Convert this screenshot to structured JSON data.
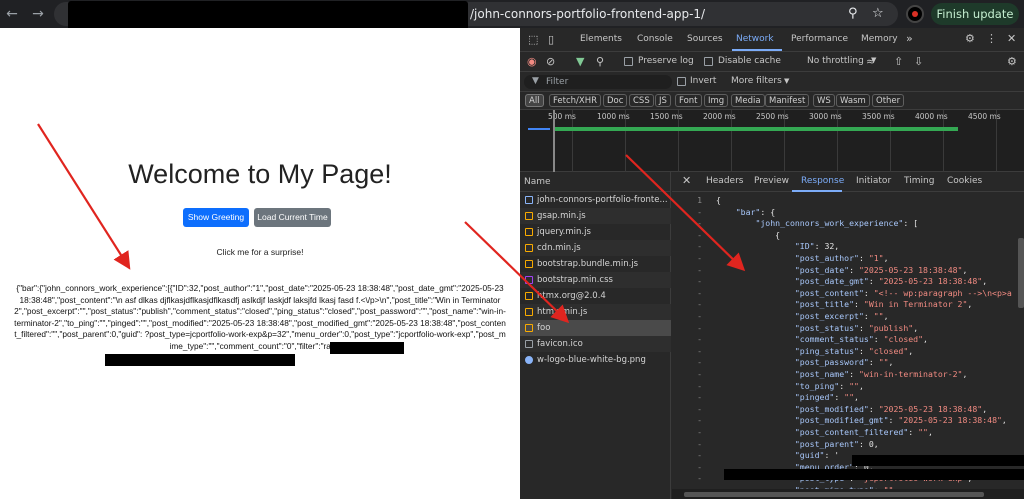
{
  "browser": {
    "url_suffix": "/john-connors-portfolio-frontend-app-1/",
    "update_label": "Finish update"
  },
  "page": {
    "title": "Welcome to My Page!",
    "buttons": [
      "Show Greeting",
      "Load Current Time"
    ],
    "surprise_text": "Click me for a surprise!",
    "json_text": "{\"bar\":{\"john_connors_work_experience\":[{\"ID\":32,\"post_author\":\"1\",\"post_date\":\"2025-05-23 18:38:48\",\"post_date_gmt\":\"2025-05-23 18:38:48\",\"post_content\":\"\\n asf dlkas djflkasjdflkasjdflkasdfj aslkdjf laskjdf laksjfd lkasj fasd f.<\\/p>\\n\",\"post_title\":\"Win in Terminator 2\",\"post_excerpt\":\"\",\"post_status\":\"publish\",\"comment_status\":\"closed\",\"ping_status\":\"closed\",\"post_password\":\"\",\"post_name\":\"win-in-terminator-2\",\"to_ping\":\"\",\"pinged\":\"\",\"post_modified\":\"2025-05-23 18:38:48\",\"post_modified_gmt\":\"2025-05-23 18:38:48\",\"post_content_filtered\":\"\",\"post_parent\":0,\"guid\": ?post_type=jcportfolio-work-exp&p=32\",\"menu_order\":0,\"post_type\":\"jcportfolio-work-exp\",\"post_mime_type\":\"\",\"comment_count\":\"0\",\"filter\":\"raw\"}]}}"
  },
  "devtools": {
    "tabs": [
      "Elements",
      "Console",
      "Sources",
      "Network",
      "Performance",
      "Memory"
    ],
    "active_tab": "Network",
    "preserve_log": "Preserve log",
    "disable_cache": "Disable cache",
    "throttling": "No throttling",
    "filter_placeholder": "Filter",
    "invert": "Invert",
    "more_filters": "More filters",
    "type_chips": [
      "All",
      "Fetch/XHR",
      "Doc",
      "CSS",
      "JS",
      "Font",
      "Img",
      "Media",
      "Manifest",
      "WS",
      "Wasm",
      "Other"
    ],
    "timeline_ticks": [
      "500 ms",
      "1000 ms",
      "1500 ms",
      "2000 ms",
      "2500 ms",
      "3000 ms",
      "3500 ms",
      "4000 ms",
      "4500 ms"
    ],
    "name_header": "Name",
    "requests": [
      {
        "name": "john-connors-portfolio-fronte...",
        "icon": "doc-icon",
        "color": "#8ab4f8"
      },
      {
        "name": "gsap.min.js",
        "icon": "script-icon",
        "color": "#f9ab00"
      },
      {
        "name": "jquery.min.js",
        "icon": "script-icon",
        "color": "#f9ab00"
      },
      {
        "name": "cdn.min.js",
        "icon": "script-icon",
        "color": "#f9ab00"
      },
      {
        "name": "bootstrap.bundle.min.js",
        "icon": "script-icon",
        "color": "#f9ab00"
      },
      {
        "name": "bootstrap.min.css",
        "icon": "css-icon",
        "color": "#a142f4"
      },
      {
        "name": "htmx.org@2.0.4",
        "icon": "script-icon",
        "color": "#f9ab00"
      },
      {
        "name": "htmx.min.js",
        "icon": "script-icon",
        "color": "#f9ab00"
      },
      {
        "name": "foo",
        "icon": "fetch-icon",
        "color": "#f9ab00"
      },
      {
        "name": "favicon.ico",
        "icon": "image-icon",
        "color": "#9aa0a6"
      },
      {
        "name": "w-logo-blue-white-bg.png",
        "icon": "wp-icon",
        "color": "#8ab4f8"
      }
    ],
    "selected_request": "foo",
    "detail_tabs": [
      "Headers",
      "Preview",
      "Response",
      "Initiator",
      "Timing",
      "Cookies"
    ],
    "active_detail_tab": "Response",
    "response_lines": [
      {
        "g": "1",
        "t": "{"
      },
      {
        "g": "-",
        "t": "    \"bar\": {"
      },
      {
        "g": "-",
        "t": "        \"john_connors_work_experience\": ["
      },
      {
        "g": "-",
        "t": "            {"
      },
      {
        "g": "-",
        "t": "                \"ID\": 32,"
      },
      {
        "g": "-",
        "t": "                \"post_author\": \"1\","
      },
      {
        "g": "-",
        "t": "                \"post_date\": \"2025-05-23 18:38:48\","
      },
      {
        "g": "-",
        "t": "                \"post_date_gmt\": \"2025-05-23 18:38:48\","
      },
      {
        "g": "-",
        "t": "                \"post_content\": \"<!-- wp:paragraph -->\\n<p>a"
      },
      {
        "g": "-",
        "t": "                \"post_title\": \"Win in Terminator 2\","
      },
      {
        "g": "-",
        "t": "                \"post_excerpt\": \"\","
      },
      {
        "g": "-",
        "t": "                \"post_status\": \"publish\","
      },
      {
        "g": "-",
        "t": "                \"comment_status\": \"closed\","
      },
      {
        "g": "-",
        "t": "                \"ping_status\": \"closed\","
      },
      {
        "g": "-",
        "t": "                \"post_password\": \"\","
      },
      {
        "g": "-",
        "t": "                \"post_name\": \"win-in-terminator-2\","
      },
      {
        "g": "-",
        "t": "                \"to_ping\": \"\","
      },
      {
        "g": "-",
        "t": "                \"pinged\": \"\","
      },
      {
        "g": "-",
        "t": "                \"post_modified\": \"2025-05-23 18:38:48\","
      },
      {
        "g": "-",
        "t": "                \"post_modified_gmt\": \"2025-05-23 18:38:48\","
      },
      {
        "g": "-",
        "t": "                \"post_content_filtered\": \"\","
      },
      {
        "g": "-",
        "t": "                \"post_parent\": 0,"
      },
      {
        "g": "-",
        "t": "                \"guid\": '"
      },
      {
        "g": "-",
        "t": "                \"menu_order\": 0,"
      },
      {
        "g": "-",
        "t": "                \"post_type\": \"jcportfolio-work-exp\","
      },
      {
        "g": "-",
        "t": "                \"post_mime_type\": \"\","
      }
    ],
    "accent_color": "#7cacf8"
  }
}
